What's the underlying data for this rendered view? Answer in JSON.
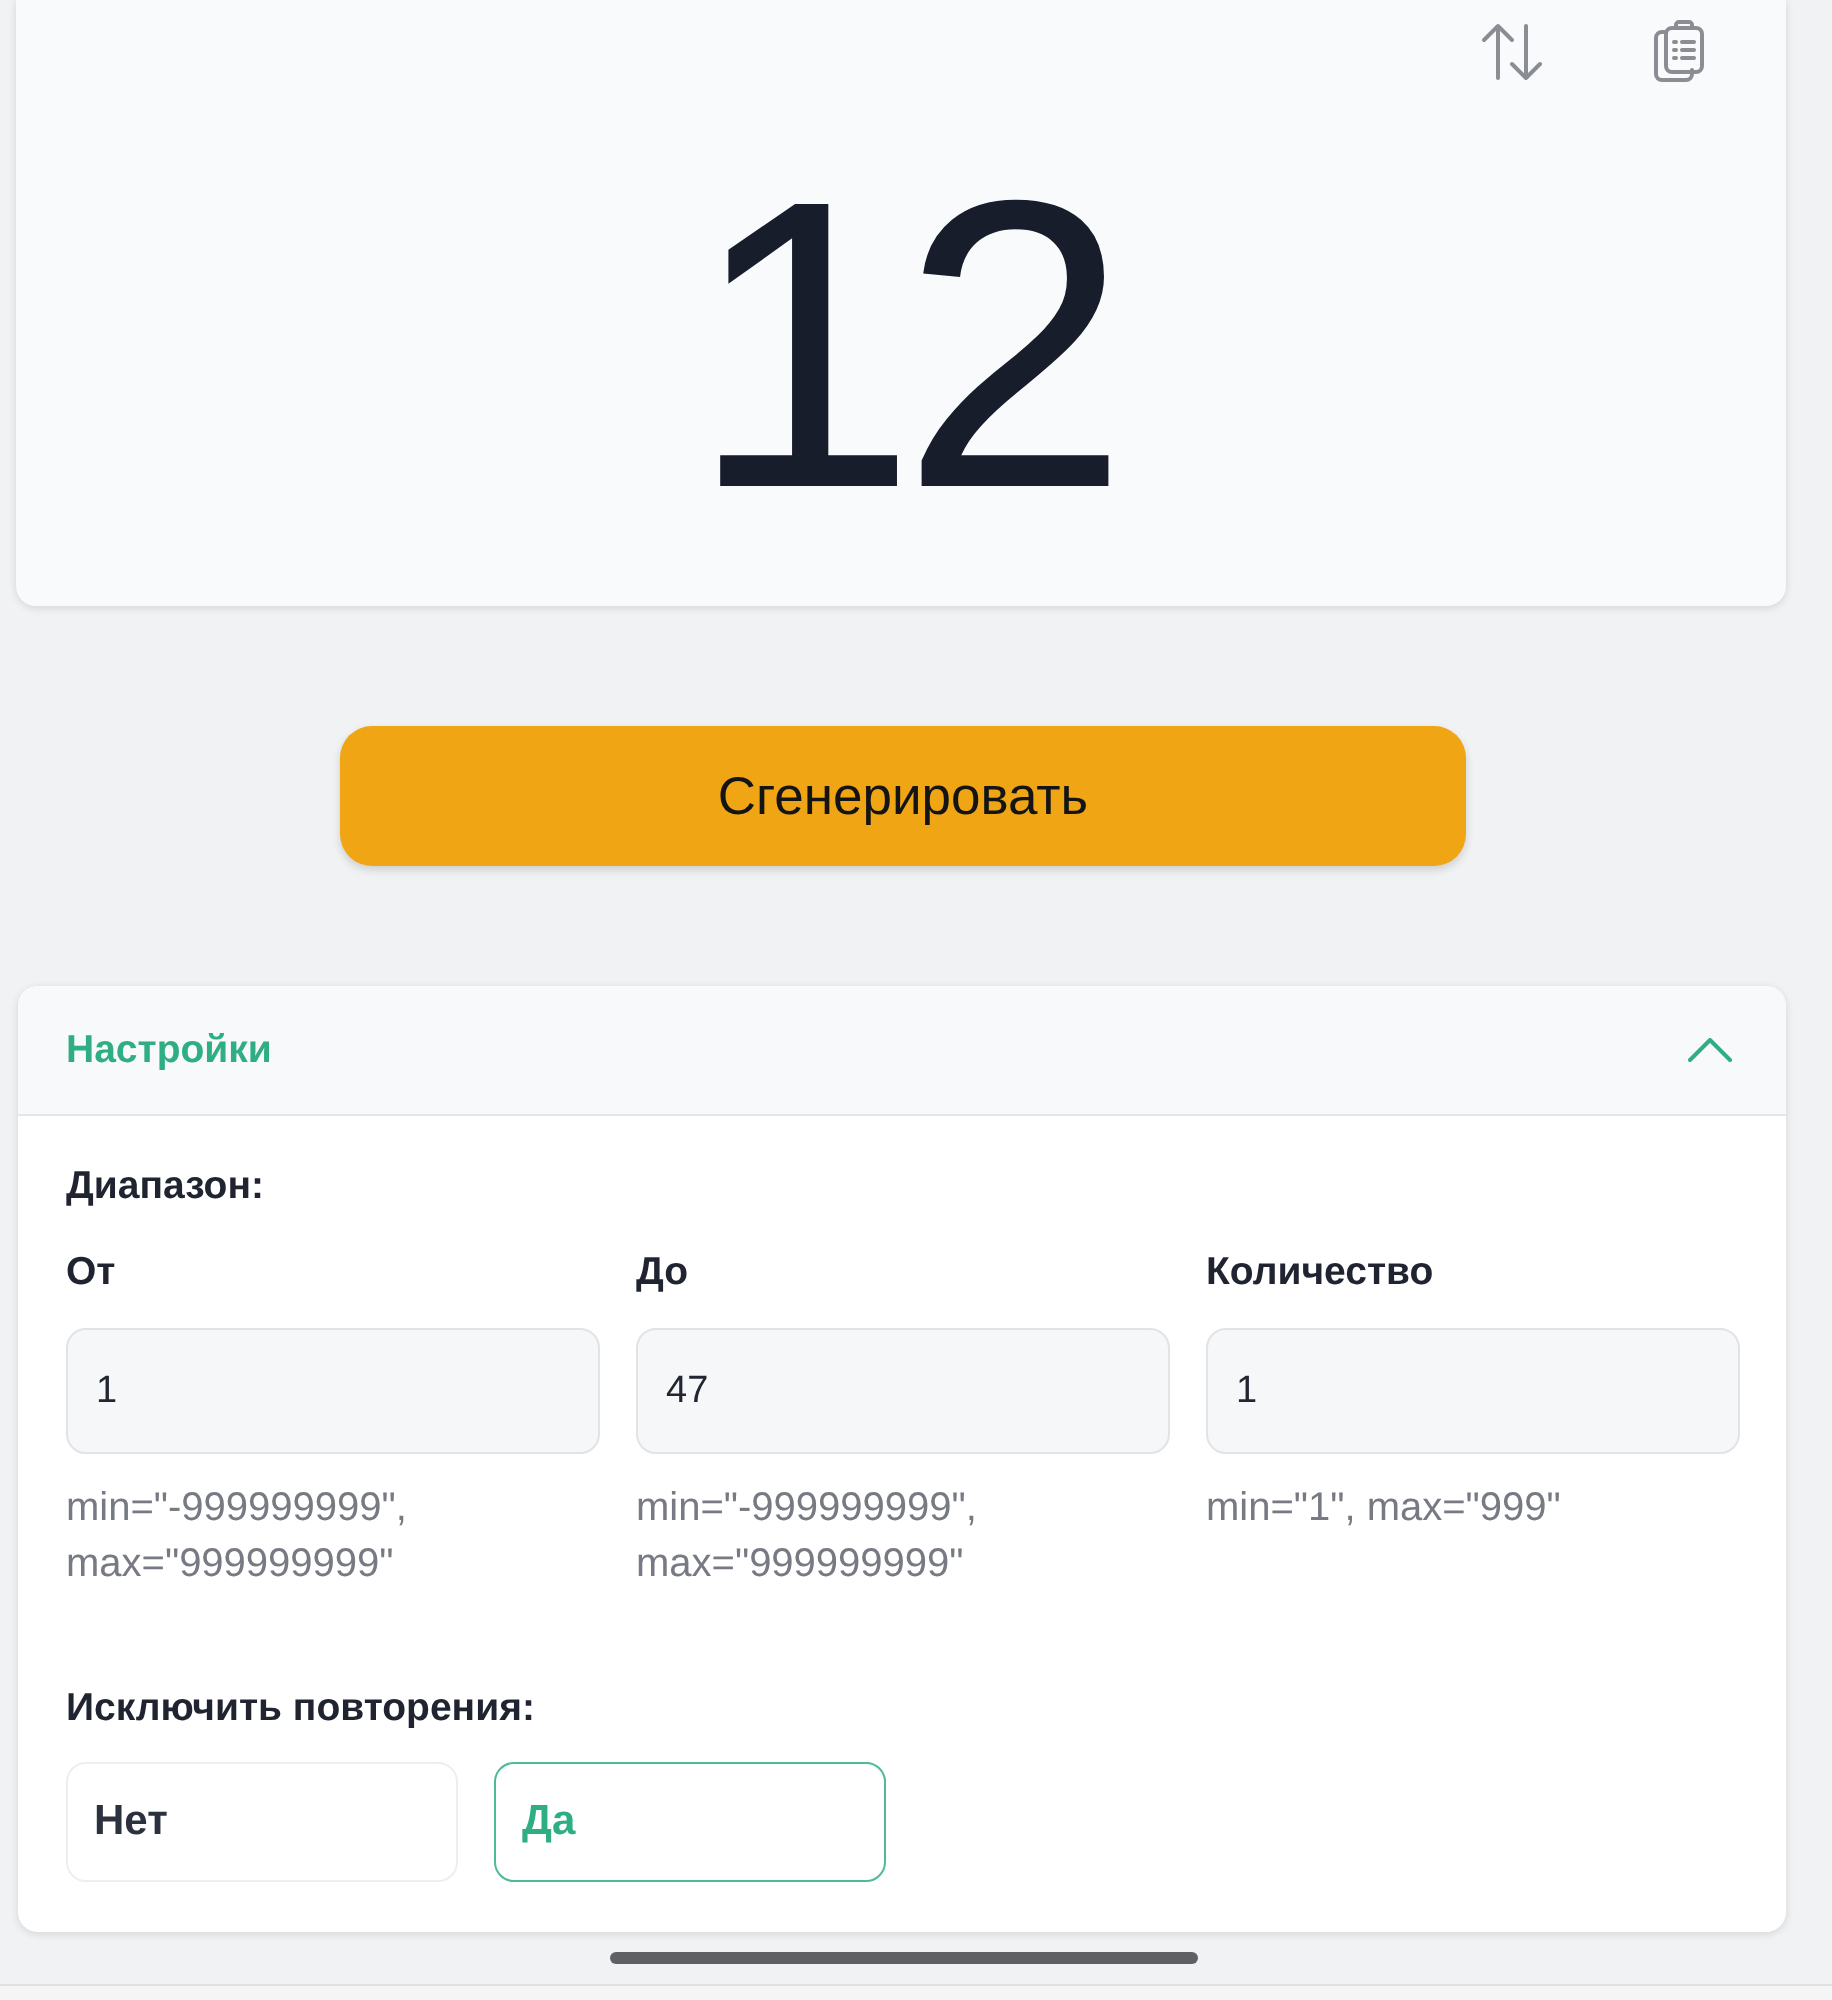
{
  "result": {
    "value": "12"
  },
  "generate_button": {
    "label": "Сгенерировать"
  },
  "settings": {
    "title": "Настройки",
    "expanded": true,
    "range_label": "Диапазон:",
    "fields": [
      {
        "label": "От",
        "value": "1",
        "hint": "min=\"-999999999\", max=\"999999999\""
      },
      {
        "label": "До",
        "value": "47",
        "hint": "min=\"-999999999\", max=\"999999999\""
      },
      {
        "label": "Количество",
        "value": "1",
        "hint": "min=\"1\", max=\"999\""
      }
    ],
    "exclude_repeats": {
      "label": "Исключить повторения:",
      "options": [
        {
          "label": "Нет",
          "selected": false
        },
        {
          "label": "Да",
          "selected": true
        }
      ]
    }
  }
}
